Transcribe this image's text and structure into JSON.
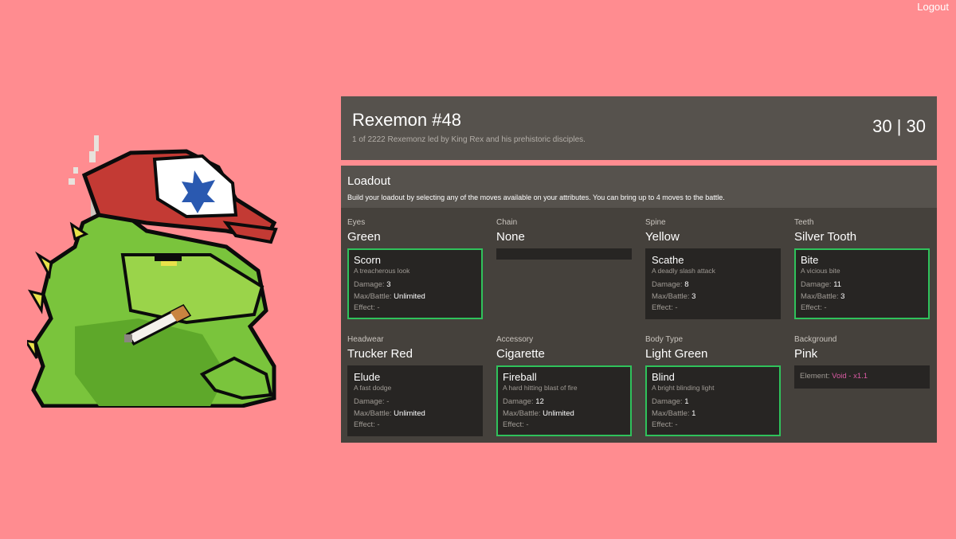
{
  "nav": {
    "logout_label": "Logout"
  },
  "header": {
    "title": "Rexemon #48",
    "subtitle": "1 of 2222 Rexemonz led by King Rex and his prehistoric disciples.",
    "hp": "30 | 30"
  },
  "loadout": {
    "title": "Loadout",
    "description": "Build your loadout by selecting any of the moves available on your attributes. You can bring up to 4 moves to the battle."
  },
  "stat_labels": {
    "damage": "Damage:",
    "max_battle": "Max/Battle:",
    "effect": "Effect:"
  },
  "attributes": [
    {
      "label": "Eyes",
      "value": "Green",
      "move": {
        "name": "Scorn",
        "description": "A treacherous look",
        "damage": "3",
        "max_battle": "Unlimited",
        "effect": "-",
        "selected": true
      }
    },
    {
      "label": "Chain",
      "value": "None",
      "move": null
    },
    {
      "label": "Spine",
      "value": "Yellow",
      "move": {
        "name": "Scathe",
        "description": "A deadly slash attack",
        "damage": "8",
        "max_battle": "3",
        "effect": "-",
        "selected": false
      }
    },
    {
      "label": "Teeth",
      "value": "Silver Tooth",
      "move": {
        "name": "Bite",
        "description": "A vicious bite",
        "damage": "11",
        "max_battle": "3",
        "effect": "-",
        "selected": true
      }
    },
    {
      "label": "Headwear",
      "value": "Trucker Red",
      "move": {
        "name": "Elude",
        "description": "A fast dodge",
        "damage": "-",
        "max_battle": "Unlimited",
        "effect": "-",
        "selected": false
      }
    },
    {
      "label": "Accessory",
      "value": "Cigarette",
      "move": {
        "name": "Fireball",
        "description": "A hard hitting blast of fire",
        "damage": "12",
        "max_battle": "Unlimited",
        "effect": "-",
        "selected": true
      }
    },
    {
      "label": "Body Type",
      "value": "Light Green",
      "move": {
        "name": "Blind",
        "description": "A bright blinding light",
        "damage": "1",
        "max_battle": "1",
        "effect": "-",
        "selected": true
      }
    },
    {
      "label": "Background",
      "value": "Pink",
      "element": {
        "label": "Element:",
        "value": "Void - x1.1"
      }
    }
  ],
  "colors": {
    "background": "#ff8c90",
    "panel": "#56524d",
    "panel_dark": "#45413c",
    "card": "#272523",
    "selected_border": "#2fc25b",
    "element_text": "#d95aa3"
  },
  "avatar": {
    "icon": "pixel-dinosaur-avatar"
  }
}
